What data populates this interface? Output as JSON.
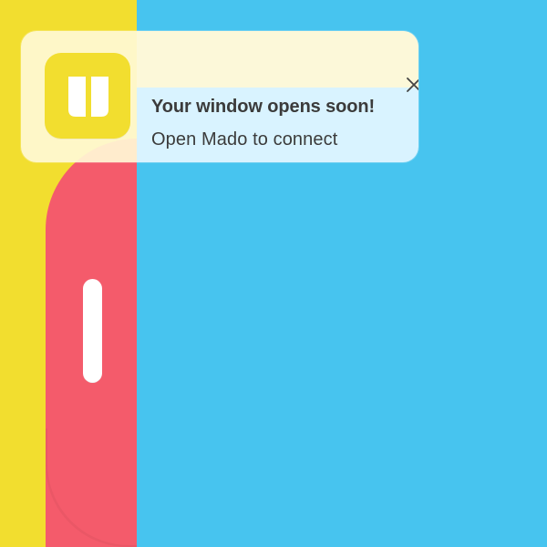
{
  "background": {
    "outer_color": "#f2de2f",
    "phone_color": "#f45b6b",
    "screen_color": "#47c4ef",
    "handle_color": "#ffffff"
  },
  "notification": {
    "title": "Your window opens soon!",
    "message": "Open Mado to connect",
    "app_icon": "mado-logo-icon",
    "close_icon": "close-icon",
    "icon_bg": "#f2de2f"
  }
}
